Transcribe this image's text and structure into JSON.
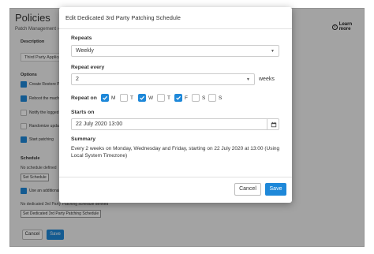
{
  "background": {
    "title": "Policies",
    "breadcrumb": "Patch Management ›",
    "learn_more": "Learn more",
    "description_label": "Description",
    "description_value": "Third Party Applications",
    "options_label": "Options",
    "options": [
      {
        "label": "Create Restore Point",
        "checked": true
      },
      {
        "label": "Reboot the machine",
        "checked": true
      },
      {
        "label": "Notify the logged in user",
        "checked": false
      },
      {
        "label": "Randomize updates",
        "checked": false
      },
      {
        "label": "Start patching",
        "checked": true
      }
    ],
    "schedule_label": "Schedule",
    "no_schedule_text": "No schedule defined",
    "set_schedule_button": "Set Schedule",
    "additional_option": "Use an additional",
    "no_dedicated_text": "No dedicated 3rd Party Patching schedule defined",
    "set_dedicated_button": "Set Dedicated 3rd Party Patching Schedule",
    "cancel_label": "Cancel",
    "save_label": "Save"
  },
  "modal": {
    "title": "Edit Dedicated 3rd Party Patching Schedule",
    "repeats_label": "Repeats",
    "repeats_value": "Weekly",
    "repeat_every_label": "Repeat every",
    "repeat_every_value": "2",
    "repeat_every_unit": "weeks",
    "repeat_on_label": "Repeat on",
    "days": [
      {
        "label": "M",
        "checked": true
      },
      {
        "label": "T",
        "checked": false
      },
      {
        "label": "W",
        "checked": true
      },
      {
        "label": "T",
        "checked": false
      },
      {
        "label": "F",
        "checked": true
      },
      {
        "label": "S",
        "checked": false
      },
      {
        "label": "S",
        "checked": false
      }
    ],
    "starts_on_label": "Starts on",
    "starts_on_value": "22 July 2020 13:00",
    "summary_label": "Summary",
    "summary_text": "Every 2 weeks on Monday, Wednesday and Friday, starting on 22 July 2020 at 13:00 (Using Local System Timezone)",
    "cancel_label": "Cancel",
    "save_label": "Save"
  },
  "colors": {
    "accent": "#1e88d9",
    "overlay": "rgba(0,0,0,0.33)"
  },
  "icons": [
    "info-icon",
    "chevron-down-icon",
    "calendar-icon",
    "check-icon"
  ]
}
